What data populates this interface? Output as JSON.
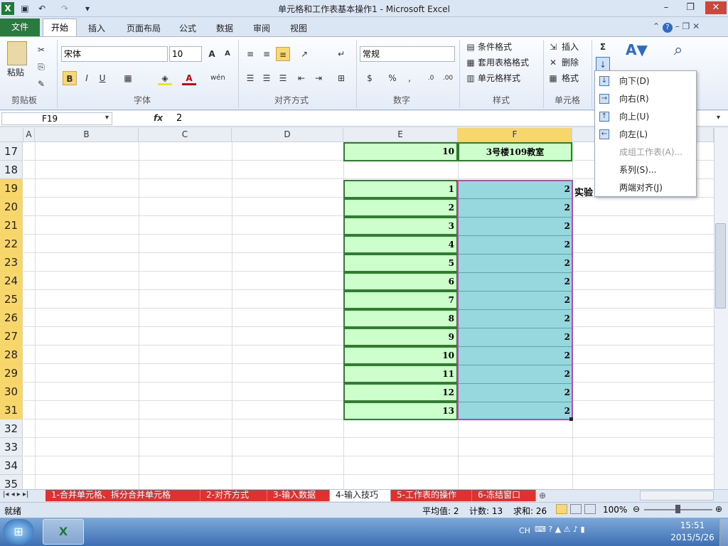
{
  "window": {
    "title": "单元格和工作表基本操作1 - Microsoft Excel"
  },
  "tabs": {
    "file": "文件",
    "home": "开始",
    "insert": "插入",
    "layout": "页面布局",
    "formula": "公式",
    "data": "数据",
    "review": "审阅",
    "view": "视图"
  },
  "ribbon": {
    "clipboard": {
      "label": "剪贴板",
      "paste": "粘贴"
    },
    "font": {
      "label": "字体",
      "name": "宋体",
      "size": "10"
    },
    "align": {
      "label": "对齐方式"
    },
    "number": {
      "label": "数字",
      "format": "常规"
    },
    "styles": {
      "label": "样式",
      "cond": "条件格式",
      "table": "套用表格格式",
      "cell": "单元格样式"
    },
    "cells": {
      "label": "单元格",
      "insert": "插入",
      "delete": "删除",
      "format": "格式"
    },
    "editing": {
      "sort": "排序和筛选",
      "find": "查找和选择"
    }
  },
  "formula_bar": {
    "name_box": "F19",
    "fx": "fx",
    "value": "2"
  },
  "columns": [
    "A",
    "B",
    "C",
    "D",
    "E",
    "F"
  ],
  "rows": [
    "17",
    "18",
    "19",
    "20",
    "21",
    "22",
    "23",
    "24",
    "25",
    "26",
    "27",
    "28",
    "29",
    "30",
    "31",
    "32",
    "33",
    "34",
    "35"
  ],
  "cells": {
    "e17": "10",
    "f17": "3号楼109教室",
    "g19": "实验",
    "e_values": [
      "1",
      "2",
      "3",
      "4",
      "5",
      "6",
      "7",
      "8",
      "9",
      "10",
      "11",
      "12",
      "13"
    ],
    "f_values": [
      "2",
      "2",
      "2",
      "2",
      "2",
      "2",
      "2",
      "2",
      "2",
      "2",
      "2",
      "2",
      "2"
    ]
  },
  "fill_menu": {
    "down": "向下(D)",
    "right": "向右(R)",
    "up": "向上(U)",
    "left": "向左(L)",
    "across": "成组工作表(A)...",
    "series": "系列(S)...",
    "justify": "两端对齐(J)"
  },
  "sheet_tabs": [
    "1-合并单元格、拆分合并单元格",
    "2-对齐方式",
    "3-输入数据",
    "4-输入技巧",
    "5-工作表的操作",
    "6-冻结窗口"
  ],
  "status": {
    "ready": "就绪",
    "avg": "平均值: 2",
    "count": "计数: 13",
    "sum": "求和: 26",
    "zoom": "100%"
  },
  "taskbar": {
    "lang": "CH",
    "time": "15:51",
    "date": "2015/5/26"
  },
  "colors": {
    "accent": "#2a7a3f",
    "selection": "#97d8df",
    "green_cell": "#ccffcc",
    "header_sel": "#f7d66b",
    "tab_red": "#e03030"
  }
}
